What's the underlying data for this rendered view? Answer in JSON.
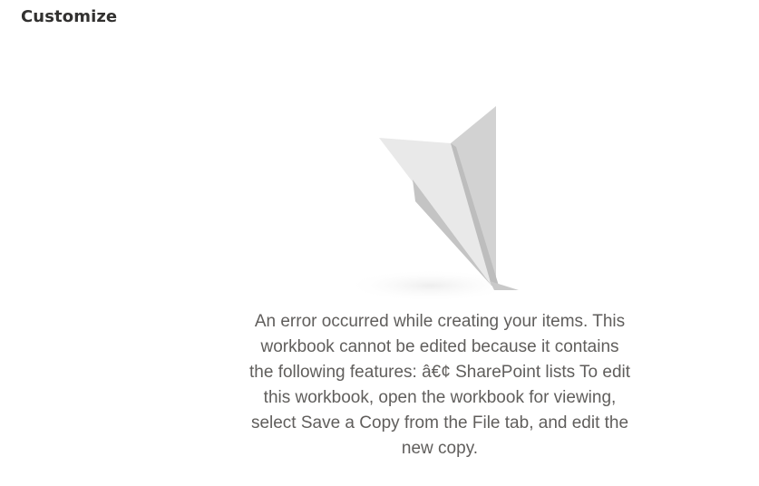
{
  "header": {
    "title": "Customize"
  },
  "illustration": {
    "icon": "paper-plane-icon"
  },
  "error": {
    "message": "An error occurred while creating your items. This workbook cannot be edited because it contains the following features: â€¢ SharePoint lists To edit this workbook, open the workbook for viewing, select Save a Copy from the File tab, and edit the new copy."
  }
}
